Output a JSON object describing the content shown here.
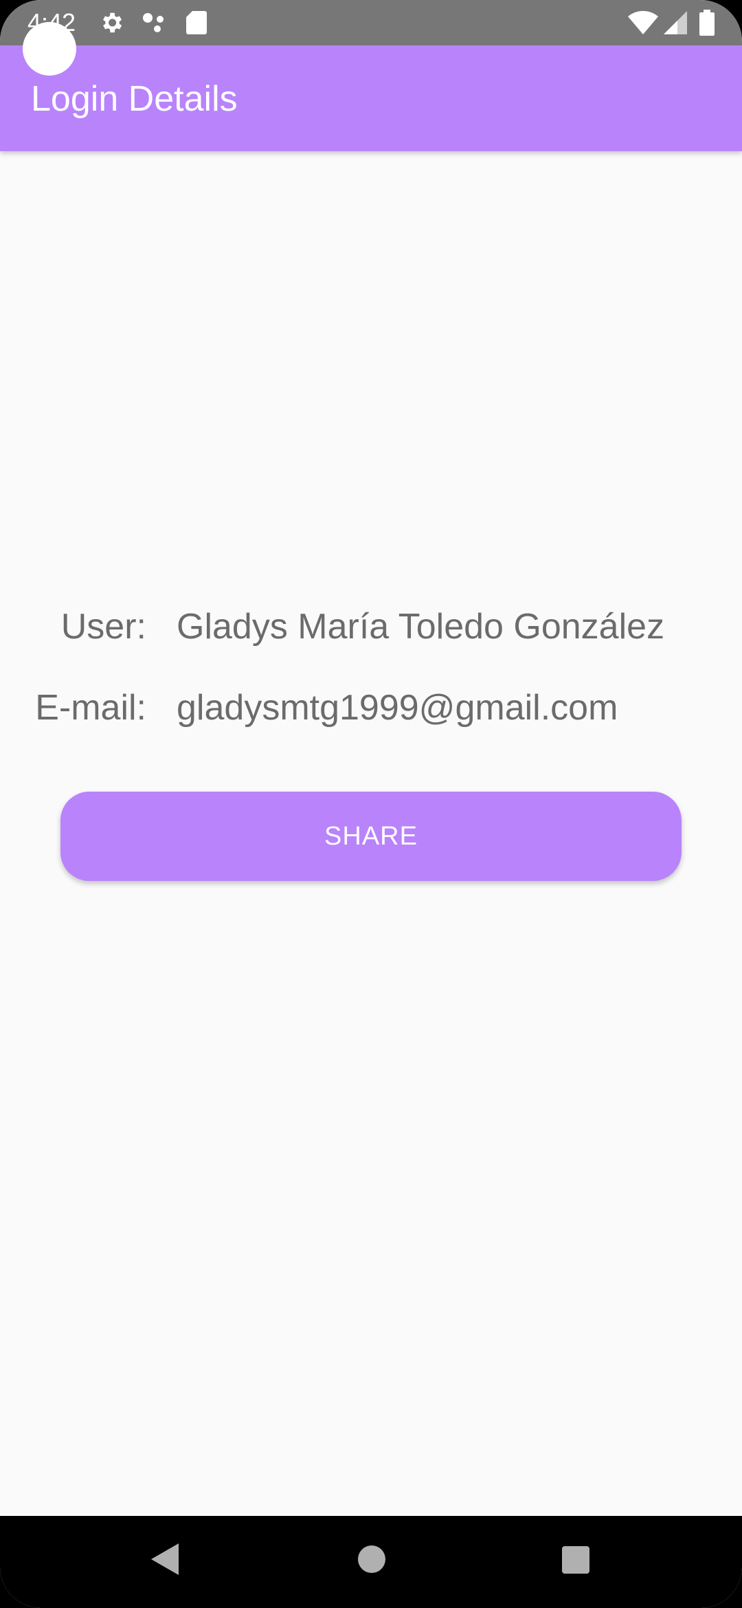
{
  "status_bar": {
    "time": "4:42",
    "icons": [
      "settings-icon",
      "assistant-dots-icon",
      "sd-card-icon",
      "wifi-icon",
      "signal-icon",
      "battery-icon"
    ]
  },
  "app_bar": {
    "title": "Login Details",
    "color": "#b983fc"
  },
  "details": {
    "user_label": "User:",
    "user_value": "Gladys María Toledo González",
    "email_label": "E-mail:",
    "email_value": "gladysmtg1999@gmail.com"
  },
  "actions": {
    "share_label": "SHARE"
  },
  "nav_bar": {
    "buttons": [
      "back-icon",
      "home-icon",
      "recents-icon"
    ]
  }
}
